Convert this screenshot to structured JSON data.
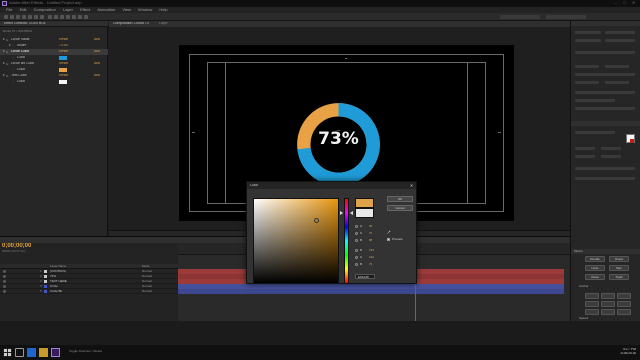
{
  "window": {
    "title": "Adobe After Effects - Untitled Project.aep"
  },
  "menu": [
    "File",
    "Edit",
    "Composition",
    "Layer",
    "Effect",
    "Animation",
    "View",
    "Window",
    "Help"
  ],
  "effect_controls": {
    "tab_label": "Effect Controls: CONTROL",
    "breadcrumb": "Donut 73 • CONTROL",
    "rows": [
      {
        "name": "Circle Value",
        "value": "Reset",
        "extra": "Abo",
        "indent": 0,
        "fx": true
      },
      {
        "name": "Slider",
        "value": "73.00",
        "extra": "",
        "indent": 1,
        "fx": false
      },
      {
        "name": "Circle Color",
        "value": "Reset",
        "extra": "Abo",
        "indent": 0,
        "fx": true,
        "highlight": true
      },
      {
        "name": "Color",
        "value": "",
        "extra": "",
        "indent": 1,
        "fx": false,
        "swatch": "#1f9bd7"
      },
      {
        "name": "Circle Bit Color",
        "value": "Reset",
        "extra": "Abo",
        "indent": 0,
        "fx": true
      },
      {
        "name": "Color",
        "value": "",
        "extra": "",
        "indent": 1,
        "fx": false,
        "swatch": "#e8a245"
      },
      {
        "name": "Text Color",
        "value": "Reset",
        "extra": "Abo",
        "indent": 0,
        "fx": true
      },
      {
        "name": "Color",
        "value": "",
        "extra": "",
        "indent": 1,
        "fx": false,
        "swatch": "#f5f5f5"
      }
    ]
  },
  "viewer": {
    "tab_label": "Composition: Donut 73",
    "tab2_label": "Layer"
  },
  "donut": {
    "percent": 73,
    "label": "73%",
    "colors": {
      "value": "#1f9bd7",
      "remainder": "#e8a245",
      "text": "#f3f3f3"
    }
  },
  "timeline": {
    "timecode": "0;00;00;00",
    "sub": "00000 (29.97 fps)",
    "columns": {
      "source": "Layer Name",
      "mode": "Mode"
    },
    "layers": [
      {
        "num": "1",
        "name": "[CONTROL]",
        "label_color": "#c9c9c9",
        "mode": "Normal",
        "bar": "#9c3a3a"
      },
      {
        "num": "2",
        "name": "73%",
        "label_color": "#c9c9c9",
        "mode": "Normal",
        "bar": "#9c3a3a"
      },
      {
        "num": "3",
        "name": "TEXT HERE",
        "label_color": "#c9c9c9",
        "mode": "Normal",
        "bar": "#9c3a3a"
      },
      {
        "num": "4",
        "name": "Circle",
        "label_color": "#3f58c9",
        "mode": "Normal",
        "bar": "#44509a"
      },
      {
        "num": "5",
        "name": "Circle Bit",
        "label_color": "#3f58c9",
        "mode": "Normal",
        "bar": "#44509a"
      }
    ]
  },
  "picker": {
    "title": "Color",
    "ok": "OK",
    "cancel": "Cancel",
    "preview": "Preview",
    "new_color": "#e0a248",
    "old_color": "#e8e8e8",
    "fields": [
      {
        "k": "H",
        "v": "36"
      },
      {
        "k": "S",
        "v": "70"
      },
      {
        "k": "B",
        "v": "88"
      },
      {
        "k": "R",
        "v": "224"
      },
      {
        "k": "G",
        "v": "162"
      },
      {
        "k": "B",
        "v": "72"
      }
    ],
    "hex": "E0A248"
  },
  "right_panel": {
    "motion_label": "Motion",
    "buttons": [
      "Doodle",
      "Orient",
      "Undo",
      "Spin",
      "Clone",
      "Trash"
    ],
    "anchor_label": "Anchor",
    "speed_label": "Speed"
  },
  "taskbar": {
    "status": "Toggle Switches / Modes",
    "clock_time": "4:17 PM",
    "clock_date": "2/26/2016"
  }
}
